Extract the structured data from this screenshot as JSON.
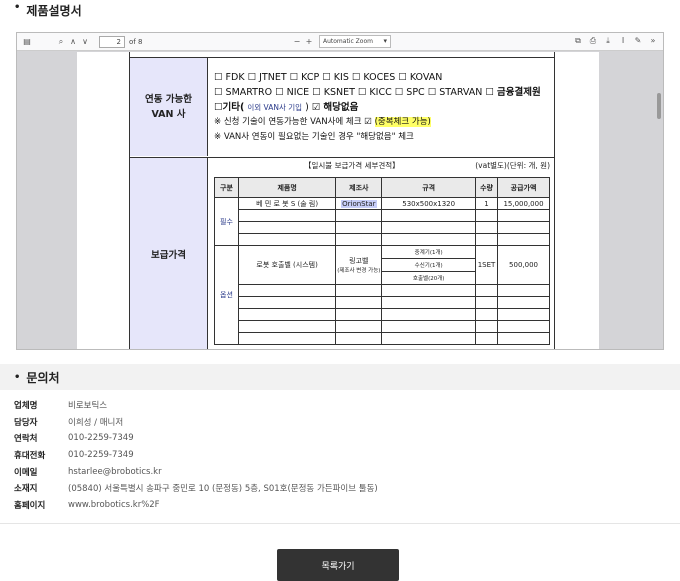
{
  "sections": {
    "spec_title": "제품설명서",
    "contact_title": "문의처"
  },
  "pdf": {
    "page_current": "2",
    "page_total": "of 8",
    "zoom": "Automatic Zoom",
    "doc": {
      "van_label_line1": "연동 가능한",
      "van_label_line2": "VAN 사",
      "van_line1": "☐ FDK ☐ JTNET ☐ KCP ☐ KIS ☐ KOCES ☐ KOVAN",
      "van_line2_a": "☐ SMARTRO ☐ NICE ☐ KSNET ☐ KICC ☐ SPC ☐ STARVAN ☐",
      "van_line2_b": "금융결제원",
      "van_line3_a": "☐기타(",
      "van_line3_b": "이외 VAN사 기입",
      "van_line3_c": ") ☑",
      "van_line3_d": "해당없음",
      "note1_a": "※ 신청 기술이 연동가능한 VAN사에 체크 ☑",
      "note1_b": "(중복체크 가능)",
      "note2": "※ VAN사 연동이 필요없는 기술인 경우 \"해당없음\" 체크",
      "price_label": "보급가격",
      "caption_title": "【일시불 보급가격 세부견적】",
      "caption_unit": "(vat별도)(단위: 개, 원)",
      "table_headers": [
        "구분",
        "제품명",
        "제조사",
        "규격",
        "수량",
        "공급가액"
      ],
      "row_required": {
        "group": "필수",
        "name": "베 민 로 봇  S (술 림)",
        "maker": "OrionStar",
        "spec": "530x500x1320",
        "qty": "1",
        "price": "15,000,000"
      },
      "row_option": {
        "group": "옵션",
        "name": "로봇 호출벨 (시스템)",
        "maker": "링고벨",
        "maker_sub": "(제조사 변경 가능)",
        "spec1": "중계기(1개)",
        "spec2": "수신기(1개)",
        "spec3": "호출벨(20개)",
        "qty": "1SET",
        "price": "500,000"
      }
    }
  },
  "contact": [
    {
      "key": "업체명",
      "value": "비로보틱스"
    },
    {
      "key": "담당자",
      "value": "이희성 / 매니저"
    },
    {
      "key": "연락처",
      "value": "010-2259-7349"
    },
    {
      "key": "휴대전화",
      "value": "010-2259-7349"
    },
    {
      "key": "이메일",
      "value": "hstarlee@brobotics.kr"
    },
    {
      "key": "소재지",
      "value": "(05840) 서울특별시 송파구 중민로 10 (문정동) 5층, S01호(문정동 가든파이브 툴동)"
    },
    {
      "key": "홈페이지",
      "value": "www.brobotics.kr%2F"
    }
  ],
  "list_button": "목록가기"
}
